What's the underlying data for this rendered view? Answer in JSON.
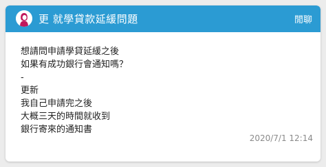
{
  "post": {
    "title": "更 就學貸款延緩問題",
    "board": "閒聊",
    "lines": [
      "想請問申請學貸延緩之後",
      "如果有成功銀行會通知嗎？",
      "-",
      "更新",
      "我自己申請完之後",
      "大概三天的時間就收到",
      "銀行寄來的通知書"
    ],
    "timestamp": "2020/7/1 12:14"
  },
  "colors": {
    "header": "#2b9bd3",
    "avatar_figure": "#c2185b",
    "text": "#222222",
    "timestamp": "#8a8a8a"
  },
  "icons": {
    "avatar": "female-avatar-icon"
  }
}
